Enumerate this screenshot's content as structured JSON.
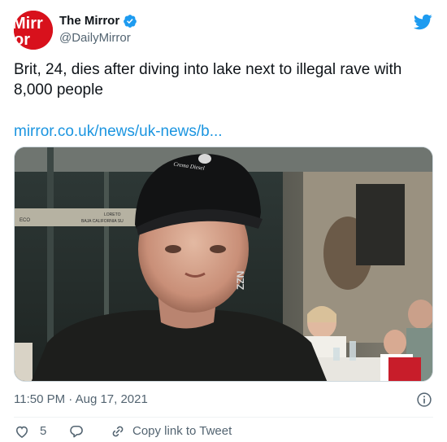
{
  "account": {
    "display_name": "The Mirror",
    "handle": "@DailyMirror",
    "avatar_text_line1": "Mirr",
    "avatar_text_line2": "or",
    "verified_icon": "verified-badge-icon",
    "platform_icon": "twitter-bird-icon",
    "brand_color": "#d8111c"
  },
  "tweet": {
    "text": "Brit, 24, dies after diving into lake next to illegal rave with 8,000 people",
    "link_text": "mirror.co.uk/news/uk-news/b...",
    "link_color": "#1b95e0"
  },
  "media": {
    "shop_sign_line1": "LORETO",
    "shop_sign_line2": "BAJA CALIFORNIA SU",
    "sign_fragment": "ECO",
    "cap_logo": "Crema Diesel",
    "wall_text": "ZZN"
  },
  "meta": {
    "timestamp": "11:50 PM · Aug 17, 2021",
    "info_icon": "info-icon"
  },
  "actions": {
    "like_count": "5",
    "like_icon": "heart-icon",
    "reply_icon": "reply-icon",
    "share_icon": "link-icon",
    "share_label": "Copy link to Tweet"
  }
}
